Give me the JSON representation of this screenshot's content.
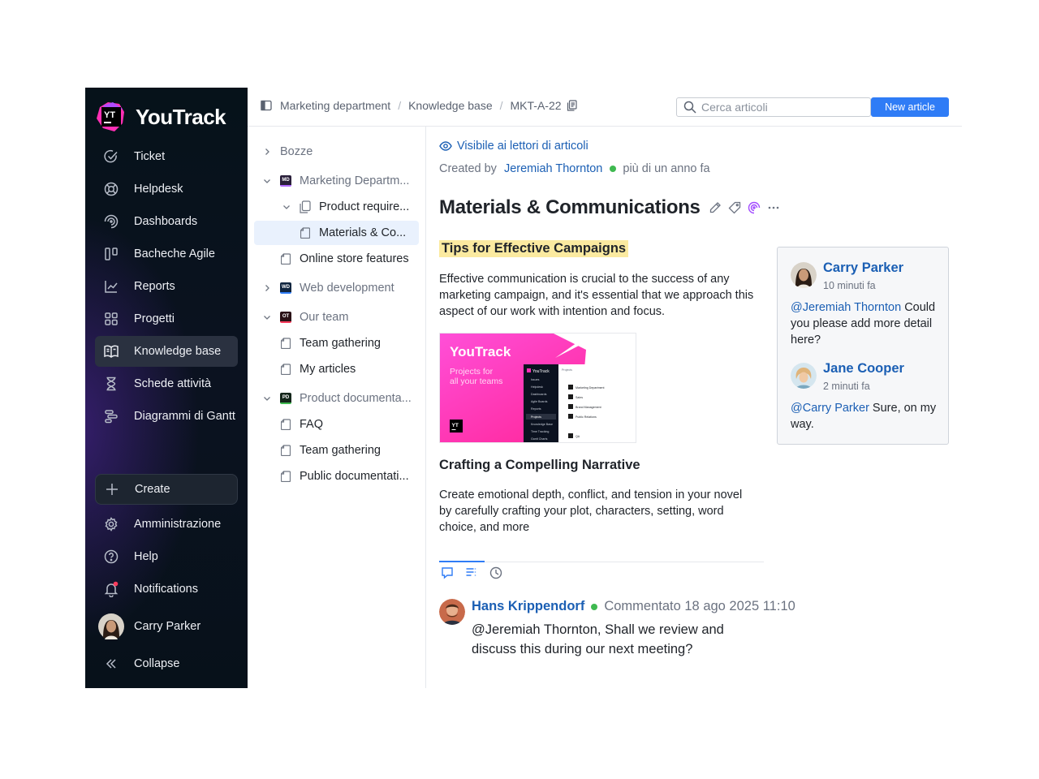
{
  "app": {
    "name": "YouTrack",
    "logo_mark": "YT"
  },
  "sidebar": {
    "items": [
      {
        "label": "Ticket",
        "icon": "check-circle-icon"
      },
      {
        "label": "Helpdesk",
        "icon": "lifebuoy-icon"
      },
      {
        "label": "Dashboards",
        "icon": "spiral-icon"
      },
      {
        "label": "Bacheche Agile",
        "icon": "board-icon"
      },
      {
        "label": "Reports",
        "icon": "chart-icon"
      },
      {
        "label": "Progetti",
        "icon": "grid-icon"
      },
      {
        "label": "Knowledge base",
        "icon": "book-icon",
        "active": true
      },
      {
        "label": "Schede attività",
        "icon": "hourglass-icon"
      },
      {
        "label": "Diagrammi di Gantt",
        "icon": "gantt-icon"
      }
    ],
    "create_label": "Create",
    "bottom": [
      {
        "label": "Amministrazione",
        "icon": "gear-icon"
      },
      {
        "label": "Help",
        "icon": "help-icon"
      },
      {
        "label": "Notifications",
        "icon": "bell-icon"
      },
      {
        "label": "Carry Parker",
        "icon": "avatar"
      },
      {
        "label": "Collapse",
        "icon": "collapse-icon"
      }
    ]
  },
  "topbar": {
    "breadcrumbs": [
      "Marketing department",
      "Knowledge base",
      "MKT-A-22"
    ],
    "search_placeholder": "Cerca articoli",
    "new_article_label": "New article"
  },
  "tree": {
    "drafts": "Bozze",
    "marketing": {
      "badge": "MD",
      "label": "Marketing Departm..."
    },
    "product_req": "Product require...",
    "materials": "Materials & Co...",
    "online_store": "Online store features",
    "webdev": {
      "badge": "WD",
      "label": "Web development"
    },
    "ourteam": {
      "badge": "OT",
      "label": "Our team"
    },
    "team_gathering_1": "Team gathering",
    "my_articles": "My articles",
    "productdoc": {
      "badge": "PD",
      "label": "Product documenta..."
    },
    "faq": "FAQ",
    "team_gathering_2": "Team gathering",
    "public_doc": "Public documentati..."
  },
  "article": {
    "visibility": "Visibile ai lettori di articoli",
    "created_by_label": "Created by",
    "author": "Jeremiah Thornton",
    "created_ago": "più di un anno fa",
    "title": "Materials & Communications",
    "highlight_heading": "Tips for Effective Campaigns",
    "para1": "Effective communication is crucial to the success of any marketing campaign, and it's essential that we approach this aspect of our work with intention and focus.",
    "hero": {
      "brand": "YouTrack",
      "tagline": "Projects for all your teams",
      "mini_logo": "YouTrack",
      "mini_menu": [
        "Issues",
        "Helpdesk",
        "Dashboards",
        "Agile Boards",
        "Reports",
        "Projects",
        "Knowledge Base",
        "Time Tracking",
        "Gantt Charts"
      ],
      "mini_projects_title": "Projects",
      "mini_projects": [
        "Marketing Department",
        "Sales",
        "Brand Management",
        "Public Relations",
        "QA"
      ],
      "mini_logo_mark": "YT"
    },
    "heading2": "Crafting a Compelling Narrative",
    "para2": "Create emotional depth, conflict, and tension in your novel by carefully crafting your plot, characters, setting, word choice, and more",
    "comment": {
      "author": "Hans Krippendorf",
      "when": "Commentato 18 ago 2025 11:10",
      "text": "@Jeremiah Thornton, Shall we review and discuss this during our next meeting?"
    }
  },
  "inline_comments": [
    {
      "author": "Carry Parker",
      "time": "10 minuti fa",
      "mention": "@Jeremiah Thornton",
      "text": " Could you please add more detail here?"
    },
    {
      "author": "Jane Cooper",
      "time": "2 minuti fa",
      "mention": "@Carry Parker",
      "text": " Sure, on my way."
    }
  ],
  "colors": {
    "accent": "#2f7cf6",
    "link": "#1b5fb4",
    "highlight": "#fbeaa0",
    "online": "#3fb950",
    "sidebar_bg": "#0b1220"
  }
}
